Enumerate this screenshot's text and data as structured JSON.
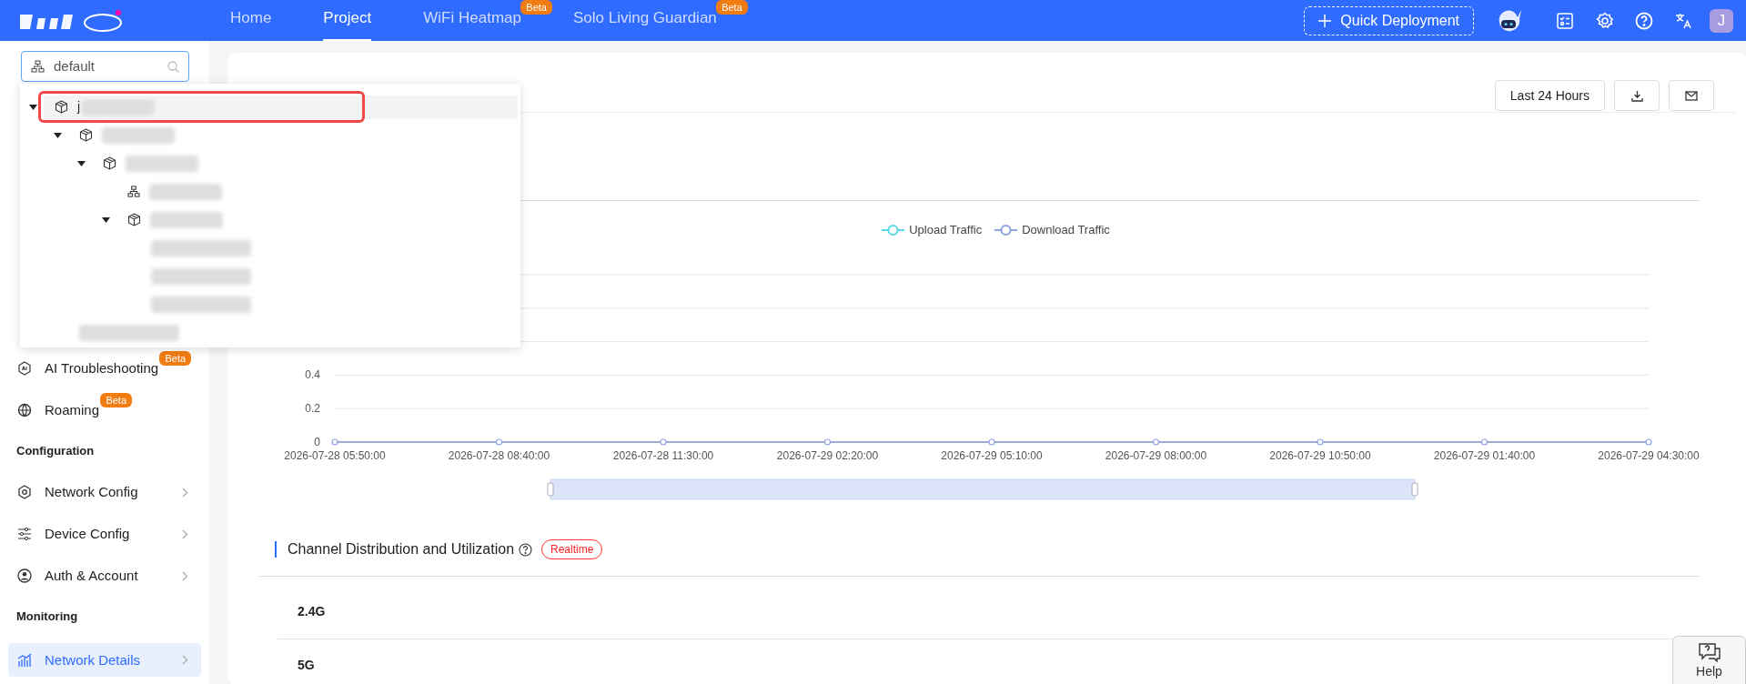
{
  "header": {
    "nav": [
      {
        "label": "Home",
        "selected": false
      },
      {
        "label": "Project",
        "selected": true
      },
      {
        "label": "WiFi Heatmap",
        "selected": false,
        "badge": "Beta"
      },
      {
        "label": "Solo Living Guardian",
        "selected": false,
        "badge": "Beta"
      }
    ],
    "quick_deploy": "Quick Deployment",
    "avatar": "J"
  },
  "project_search": {
    "value": "default"
  },
  "tree": [
    {
      "kind": "site",
      "label": "j",
      "expanded": true,
      "selected": true,
      "children": [
        {
          "kind": "site",
          "expanded": true,
          "selected": false,
          "children": [
            {
              "kind": "site",
              "expanded": true,
              "selected": false,
              "children": [
                {
                  "kind": "group",
                  "selected": false
                },
                {
                  "kind": "site",
                  "expanded": true,
                  "selected": false,
                  "children": [
                    {
                      "kind": "blurred",
                      "selected": false
                    },
                    {
                      "kind": "blurred",
                      "selected": false
                    },
                    {
                      "kind": "blurred",
                      "selected": false
                    }
                  ]
                }
              ]
            }
          ]
        },
        {
          "kind": "blurred",
          "selected": false
        }
      ]
    }
  ],
  "sidebar": [
    {
      "kind": "item",
      "label": "AI Troubleshooting",
      "badge": "Beta",
      "chevron": false,
      "selected": false
    },
    {
      "kind": "item",
      "label": "Roaming",
      "badge": "Beta",
      "chevron": false,
      "selected": false
    },
    {
      "kind": "heading",
      "label": "Configuration"
    },
    {
      "kind": "item",
      "label": "Network Config",
      "chevron": true,
      "selected": false
    },
    {
      "kind": "item",
      "label": "Device Config",
      "chevron": true,
      "selected": false
    },
    {
      "kind": "item",
      "label": "Auth & Account",
      "chevron": true,
      "selected": false
    },
    {
      "kind": "heading",
      "label": "Monitoring"
    },
    {
      "kind": "item",
      "label": "Network Details",
      "chevron": true,
      "selected": true
    }
  ],
  "toolbar": {
    "range": "Last 24 Hours"
  },
  "traffic_chart": {
    "chart_data": {
      "type": "line",
      "ylim": [
        0,
        1
      ],
      "yticks": [
        0,
        0.2,
        0.4
      ],
      "categories": [
        "2026-07-28 05:50:00",
        "2026-07-28 08:40:00",
        "2026-07-28 11:30:00",
        "2026-07-29 02:20:00",
        "2026-07-29 05:10:00",
        "2026-07-29 08:00:00",
        "2026-07-29 10:50:00",
        "2026-07-29 01:40:00",
        "2026-07-29 04:30:00"
      ],
      "series": [
        {
          "name": "Upload Traffic",
          "color": "#5ad8e6",
          "marker": true,
          "values": [
            null,
            null,
            null,
            null,
            null,
            null,
            null,
            null,
            null
          ]
        },
        {
          "name": "Download Traffic",
          "color": "#8fa3e0",
          "marker": true,
          "values": [
            0,
            0,
            0,
            0,
            0,
            0,
            0,
            0,
            0
          ]
        }
      ]
    }
  },
  "channel_section": {
    "title": "Channel Distribution and Utilization",
    "badge": "Realtime",
    "bands": [
      "2.4G",
      "5G"
    ]
  },
  "help": {
    "label": "Help"
  }
}
